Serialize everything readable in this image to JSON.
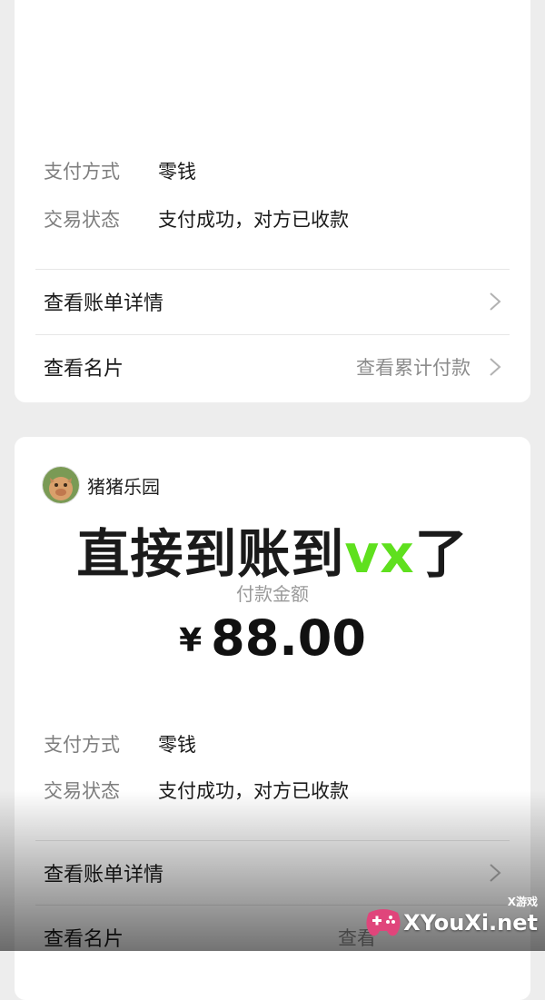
{
  "colors": {
    "page_bg": "#ededed",
    "card_bg": "#ffffff",
    "label_gray": "#7e7e7e",
    "caption_green": "#5fe01e",
    "watermark_pink": "#e0457b"
  },
  "card1": {
    "payment_method_label": "支付方式",
    "payment_method_value": "零钱",
    "status_label": "交易状态",
    "status_value": "支付成功，对方已收款",
    "bill_details": "查看账单详情",
    "view_card": "查看名片",
    "view_cumulative": "查看累计付款"
  },
  "card2": {
    "merchant_name": "猪猪乐园",
    "merchant_avatar_icon": "pig-avatar-icon",
    "pay_amount_label": "付款金额",
    "currency": "¥",
    "amount": "88.00",
    "payment_method_label": "支付方式",
    "payment_method_value": "零钱",
    "status_label": "交易状态",
    "status_value": "支付成功，对方已收款",
    "bill_details": "查看账单详情",
    "view_card": "查看名片",
    "view_cumulative": "查看"
  },
  "overlay": {
    "caption_main": "直接到账到",
    "caption_accent": "vx",
    "caption_tail": "了"
  },
  "watermark": {
    "tag": "X游戏",
    "site": "XYouXi.net",
    "logo_icon": "gamepad-logo-icon"
  }
}
